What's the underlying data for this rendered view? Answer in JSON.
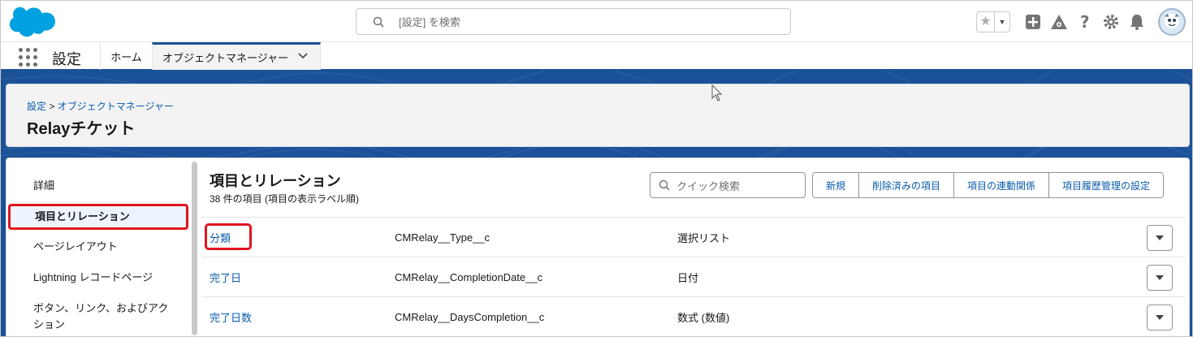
{
  "header": {
    "search_placeholder": "[設定] を検索"
  },
  "context_bar": {
    "app_name": "設定",
    "tabs": [
      {
        "label": "ホーム"
      },
      {
        "label": "オブジェクトマネージャー"
      }
    ]
  },
  "page_header": {
    "breadcrumb_root": "設定",
    "breadcrumb_sep": ">",
    "breadcrumb_current": "オブジェクトマネージャー",
    "title": "Relayチケット"
  },
  "sidebar": {
    "items": [
      {
        "label": "詳細"
      },
      {
        "label": "項目とリレーション"
      },
      {
        "label": "ページレイアウト"
      },
      {
        "label": "Lightning レコードページ"
      },
      {
        "label": "ボタン、リンク、およびアク"
      },
      {
        "label": "ション"
      }
    ]
  },
  "section": {
    "title": "項目とリレーション",
    "subtitle": "38 件の項目 (項目の表示ラベル順)",
    "quick_search_placeholder": "クイック検索",
    "buttons": [
      "新規",
      "削除済みの項目",
      "項目の連動関係",
      "項目履歴管理の設定"
    ]
  },
  "fields": [
    {
      "label": "分類",
      "api_name": "CMRelay__Type__c",
      "type": "選択リスト"
    },
    {
      "label": "完了日",
      "api_name": "CMRelay__CompletionDate__c",
      "type": "日付"
    },
    {
      "label": "完了日数",
      "api_name": "CMRelay__DaysCompletion__c",
      "type": "数式 (数値)"
    }
  ],
  "colors": {
    "brand_blue": "#1b5297",
    "link": "#0b5cab",
    "highlight_red": "#e0141e",
    "salesforce_cloud": "#00a1e0"
  }
}
